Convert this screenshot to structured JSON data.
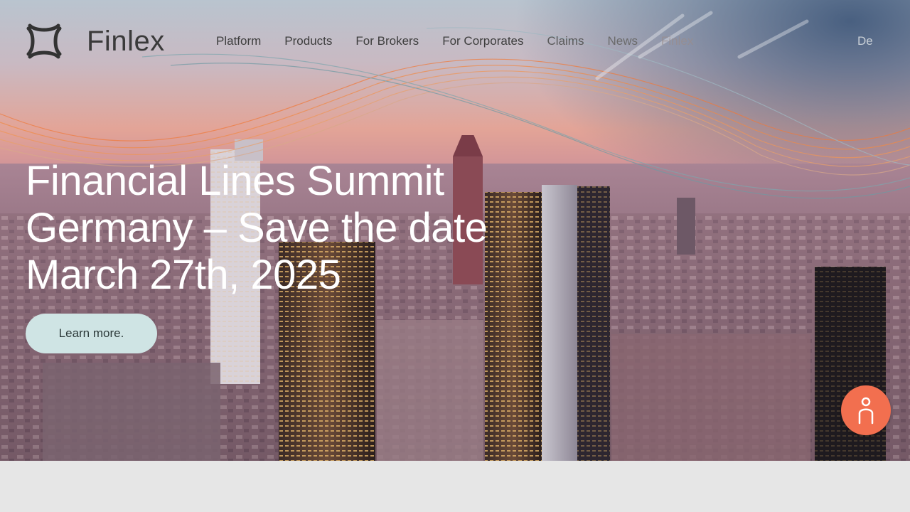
{
  "brand": {
    "name": "Finlex"
  },
  "nav": {
    "items": [
      {
        "label": "Platform"
      },
      {
        "label": "Products"
      },
      {
        "label": "For Brokers"
      },
      {
        "label": "For Corporates"
      },
      {
        "label": "Claims"
      },
      {
        "label": "News"
      },
      {
        "label": "Finlex"
      }
    ],
    "language": "De"
  },
  "hero": {
    "headline": "Financial Lines Summit Germany – Save the date March 27th, 2025",
    "cta_label": "Learn more."
  },
  "chat": {
    "icon": "person-icon",
    "color": "#f26f4f"
  },
  "colors": {
    "cta_bg": "#cfe4e4",
    "accent": "#f26f4f"
  }
}
